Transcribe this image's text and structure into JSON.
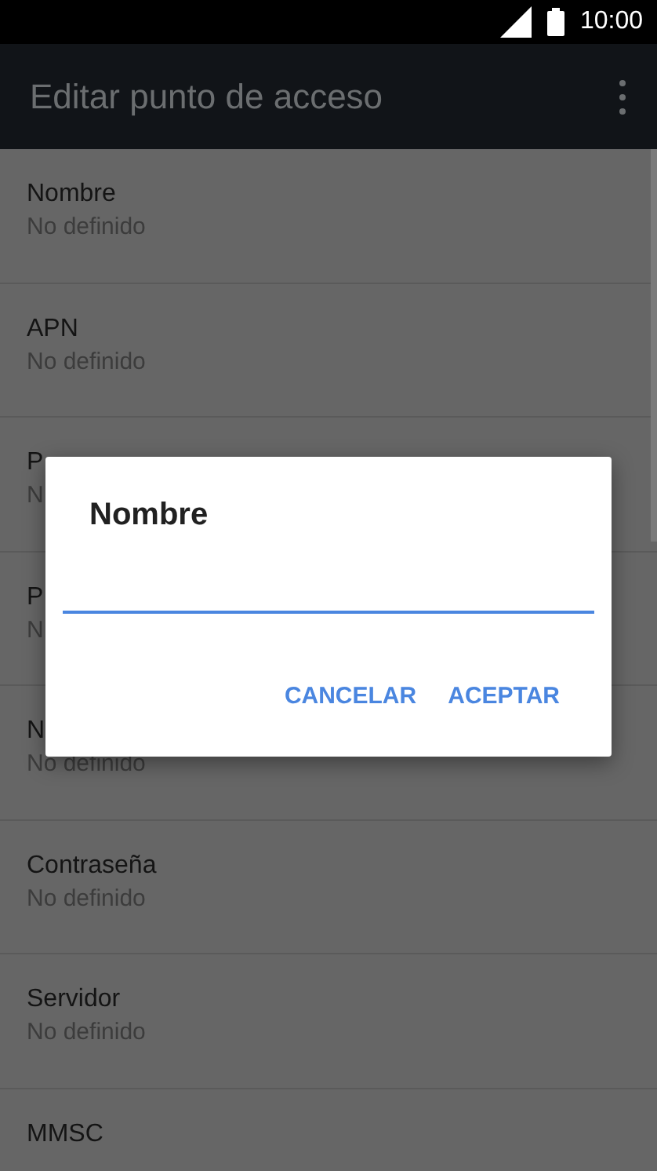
{
  "status_bar": {
    "time": "10:00"
  },
  "app_bar": {
    "title": "Editar punto de acceso"
  },
  "settings": [
    {
      "name": "Nombre",
      "value": "No definido"
    },
    {
      "name": "APN",
      "value": "No definido"
    },
    {
      "name": "P",
      "value": "N"
    },
    {
      "name": "P",
      "value": "N"
    },
    {
      "name": "N",
      "value": "No definido"
    },
    {
      "name": "Contraseña",
      "value": "No definido"
    },
    {
      "name": "Servidor",
      "value": "No definido"
    },
    {
      "name": "MMSC"
    }
  ],
  "dialog": {
    "title": "Nombre",
    "buttons": [
      "CANCELAR",
      "ACEPTAR"
    ]
  }
}
